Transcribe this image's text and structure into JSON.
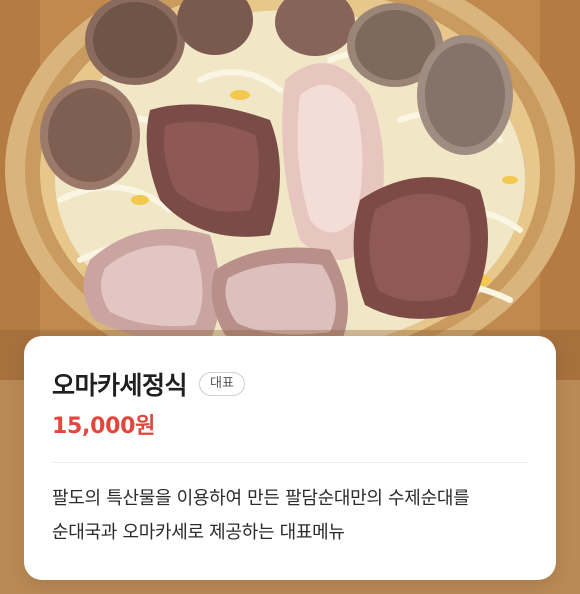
{
  "menu_item": {
    "image_alt": "",
    "name": "오마카세정식",
    "badge": "대표",
    "price": "15,000원",
    "description": "팔도의 특산물을 이용하여 만든 팔담순대만의 수제순대를 순대국과 오마카세로 제공하는 대표메뉴"
  },
  "colors": {
    "price": "#e2473d",
    "card_background": "#ffffff",
    "badge_border": "#cfcfcf"
  }
}
